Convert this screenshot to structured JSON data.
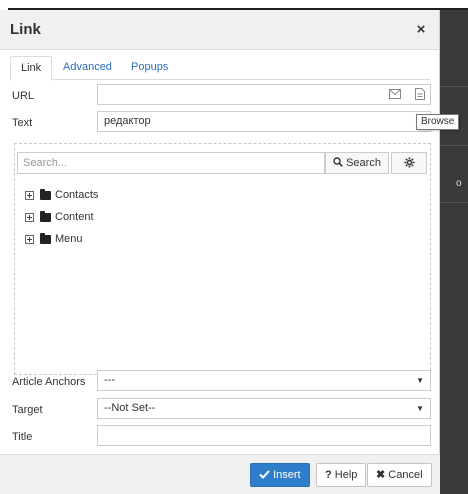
{
  "dialog": {
    "title": "Link",
    "close_glyph": "×"
  },
  "tabs": [
    {
      "label": "Link",
      "active": true
    },
    {
      "label": "Advanced",
      "active": false
    },
    {
      "label": "Popups",
      "active": false
    }
  ],
  "fields": {
    "url_label": "URL",
    "url_value": "",
    "text_label": "Text",
    "text_value": "редактор",
    "article_anchors_label": "Article Anchors",
    "article_anchors_value": "---",
    "target_label": "Target",
    "target_value": "--Not Set--",
    "title_label": "Title",
    "title_value": ""
  },
  "tooltip": "Browse",
  "browser": {
    "search_placeholder": "Search...",
    "search_button": "Search",
    "tree": [
      {
        "label": "Contacts"
      },
      {
        "label": "Content"
      },
      {
        "label": "Menu"
      }
    ]
  },
  "footer": {
    "insert": "Insert",
    "help": "Help",
    "cancel": "Cancel"
  },
  "backdrop_peek": "o",
  "icons": {
    "close": "close-icon",
    "email": "envelope-icon",
    "browse": "file-icon",
    "search": "search-icon",
    "settings": "gear-icon",
    "insert": "check-icon",
    "help": "question-icon",
    "cancel": "x-icon"
  },
  "colors": {
    "primary": "#2f7ecb",
    "tab_link": "#2a6fc0"
  }
}
